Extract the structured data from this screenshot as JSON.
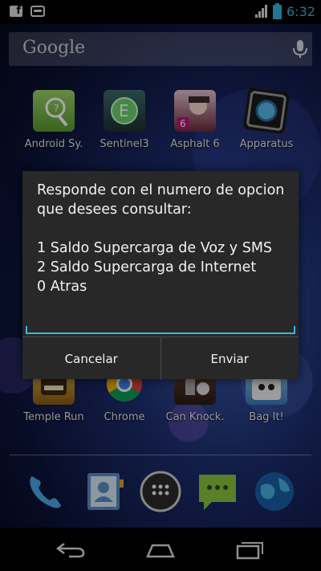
{
  "status_bar": {
    "time": "6:32",
    "icons": [
      "facebook-icon",
      "messages-icon",
      "signal-icon",
      "battery-icon"
    ]
  },
  "search": {
    "label": "Google",
    "icon": "mic-icon"
  },
  "home_row_1": [
    {
      "label": "Android Sy.",
      "icon": "android-system-icon"
    },
    {
      "label": "Sentinel3",
      "icon": "sentinel3-icon"
    },
    {
      "label": "Asphalt 6",
      "icon": "asphalt6-icon"
    },
    {
      "label": "Apparatus",
      "icon": "apparatus-icon"
    }
  ],
  "home_row_2": [
    {
      "label": "Temple Run",
      "icon": "temple-run-icon"
    },
    {
      "label": "Chrome",
      "icon": "chrome-icon"
    },
    {
      "label": "Can Knock.",
      "icon": "can-knockdown-icon"
    },
    {
      "label": "Bag It!",
      "icon": "bag-it-icon"
    }
  ],
  "dock": [
    "phone-icon",
    "contacts-icon",
    "app-drawer-icon",
    "messaging-icon",
    "browser-icon"
  ],
  "dialog": {
    "message": "Responde con el numero de opcion que desees consultar:\n\n1 Saldo Supercarga de Voz y SMS\n2 Saldo Supercarga de Internet\n0 Atras",
    "input_value": "",
    "cancel_label": "Cancelar",
    "send_label": "Enviar"
  },
  "nav_bar": [
    "back-icon",
    "home-icon",
    "recent-apps-icon"
  ],
  "colors": {
    "accent": "#33b5e5",
    "dialog_bg": "#282828"
  }
}
